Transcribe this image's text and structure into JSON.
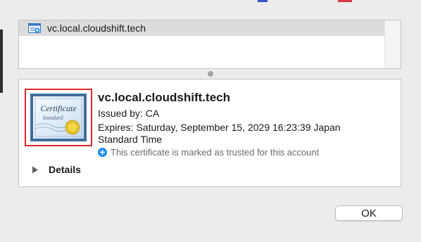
{
  "certificate_list": {
    "items": [
      {
        "label": "vc.local.cloudshift.tech",
        "icon": "certificate-icon"
      }
    ]
  },
  "details": {
    "common_name": "vc.local.cloudshift.tech",
    "issued_by": "Issued by: CA",
    "expires": "Expires: Saturday, September 15, 2029 16:23:39 Japan Standard Time",
    "trust_message": "This certificate is marked as trusted for this account",
    "trust_icon": "plus-circle-icon",
    "image_text_1": "Certificate",
    "image_text_2": "Standard",
    "disclosure_label": "Details"
  },
  "actions": {
    "ok_label": "OK"
  },
  "colors": {
    "highlight_border": "#e0252d",
    "trust_blue": "#1d8cf2",
    "selection_row": "#dcdcdc"
  }
}
